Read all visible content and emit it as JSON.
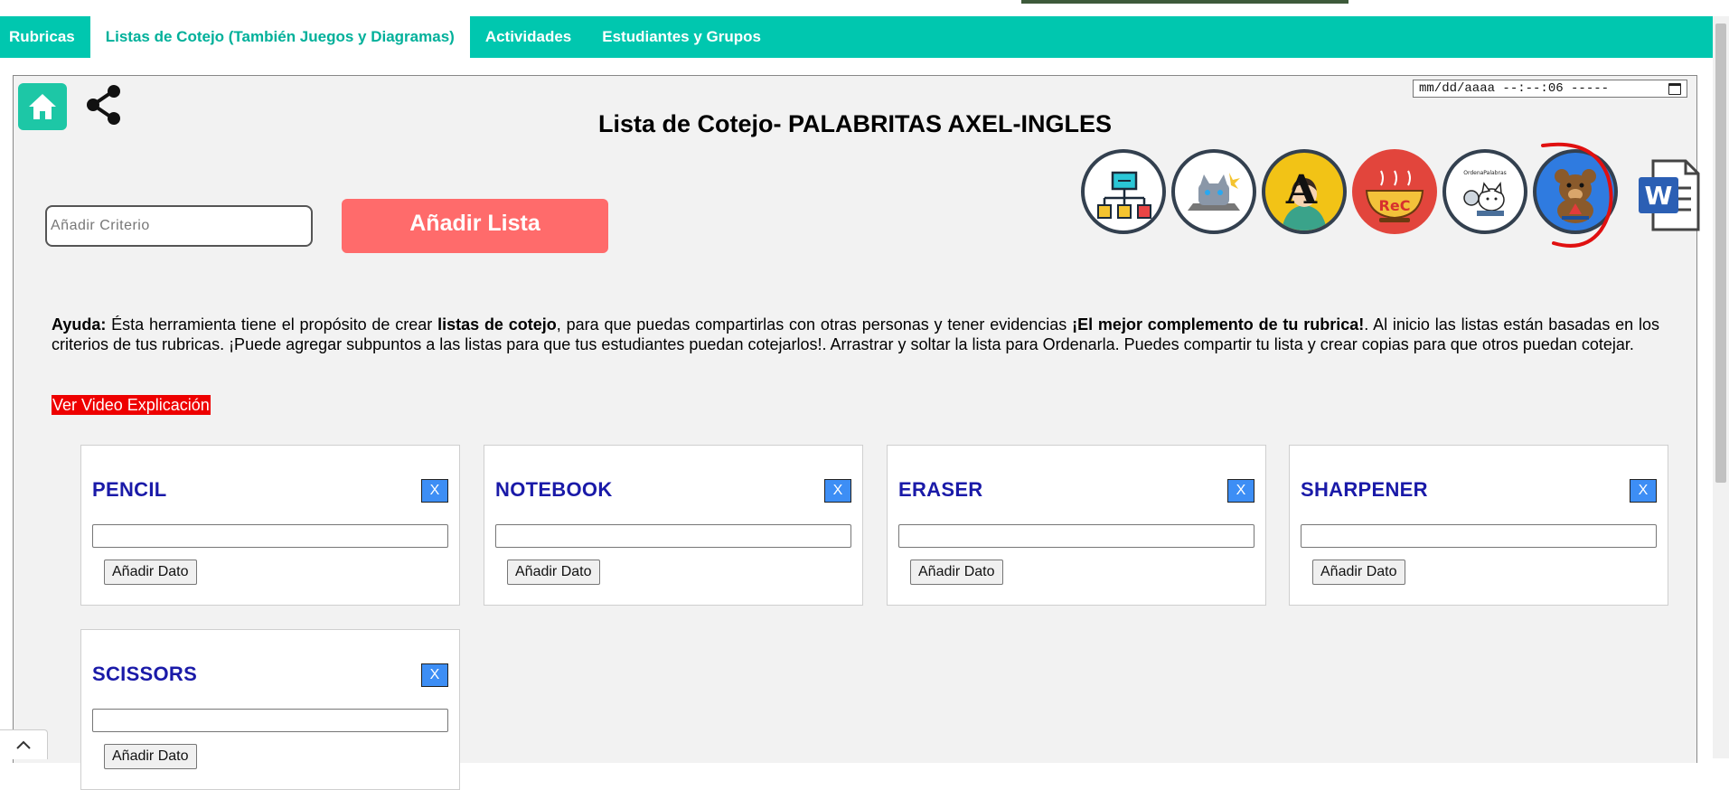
{
  "nav": {
    "tabs": [
      {
        "label": "Rubricas",
        "active": false
      },
      {
        "label": "Listas de Cotejo (También Juegos y Diagramas)",
        "active": true
      },
      {
        "label": "Actividades",
        "active": false
      },
      {
        "label": "Estudiantes y Grupos",
        "active": false
      }
    ]
  },
  "header": {
    "title": "Lista de Cotejo- PALABRITAS AXEL-INGLES",
    "datetime_value": "mm/dd/aaaa --:--:06 -----"
  },
  "tools": {
    "icons": [
      "diagram-icon",
      "cat-robot-icon",
      "letter-a-icon",
      "word-soup-icon",
      "ordena-palabras-icon",
      "bear-icon",
      "word-document-icon"
    ],
    "ordena_label": "OrdenaPalabras",
    "soup_letters": "ReC",
    "letter_a": "A",
    "word_letter": "W"
  },
  "form": {
    "criterio_placeholder": "Añadir Criterio",
    "add_list_label": "Añadir Lista"
  },
  "help": {
    "label": "Ayuda:",
    "text1": " Ésta herramienta tiene el propósito de crear ",
    "bold1": "listas de cotejo",
    "text2": ", para que puedas compartirlas con otras personas y tener evidencias ",
    "bold2": "¡El mejor complemento de tu rubrica!",
    "text3": ". Al inicio las listas están basadas en los criterios de tus rubricas. ¡Puede agregar subpuntos a las listas para que tus estudiantes puedan cotejarlos!. Arrastrar y soltar la lista para Ordenarla. Puedes compartir tu lista y crear copias para que otros puedan cotejar.",
    "video_link": "Ver Video Explicación"
  },
  "lists": [
    {
      "title": "PENCIL",
      "close_label": "X",
      "add_label": "Añadir Dato"
    },
    {
      "title": "NOTEBOOK",
      "close_label": "X",
      "add_label": "Añadir Dato"
    },
    {
      "title": "ERASER",
      "close_label": "X",
      "add_label": "Añadir Dato"
    },
    {
      "title": "SHARPENER",
      "close_label": "X",
      "add_label": "Añadir Dato"
    },
    {
      "title": "SCISSORS",
      "close_label": "X",
      "add_label": "Añadir Dato"
    }
  ],
  "colors": {
    "accent": "#00c7af",
    "button_red": "#ff6b6b",
    "title_blue": "#1a1aa8",
    "close_blue": "#3d8ef5",
    "link_red": "#ee0000"
  }
}
